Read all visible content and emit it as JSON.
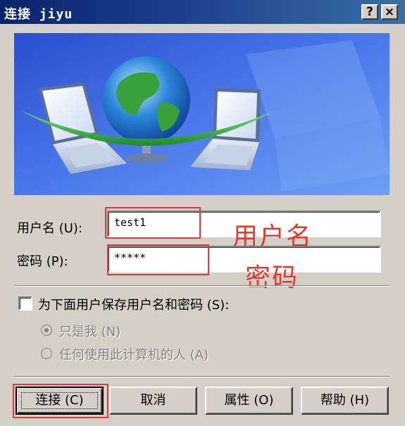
{
  "window": {
    "title": "连接 jiyu",
    "help_label": "?",
    "close_label": "×"
  },
  "form": {
    "username_label": "用户名 (U):",
    "username_value": "test1",
    "password_label": "密码 (P):",
    "password_value": "*****",
    "save_label": "为下面用户保存用户名和密码 (S):",
    "save_checked": false,
    "radio_only_me": "只是我 (N)",
    "radio_anyone": "任何使用此计算机的人 (A)"
  },
  "annotations": {
    "username_note": "用户名",
    "password_note": "密码"
  },
  "buttons": {
    "connect": "连接 (C)",
    "cancel": "取消",
    "properties": "属性 (O)",
    "help": "帮助 (H)"
  },
  "colors": {
    "annotation_red": "#e0392e",
    "titlebar": "#0a246a",
    "banner_blue": "#3d64d8"
  }
}
